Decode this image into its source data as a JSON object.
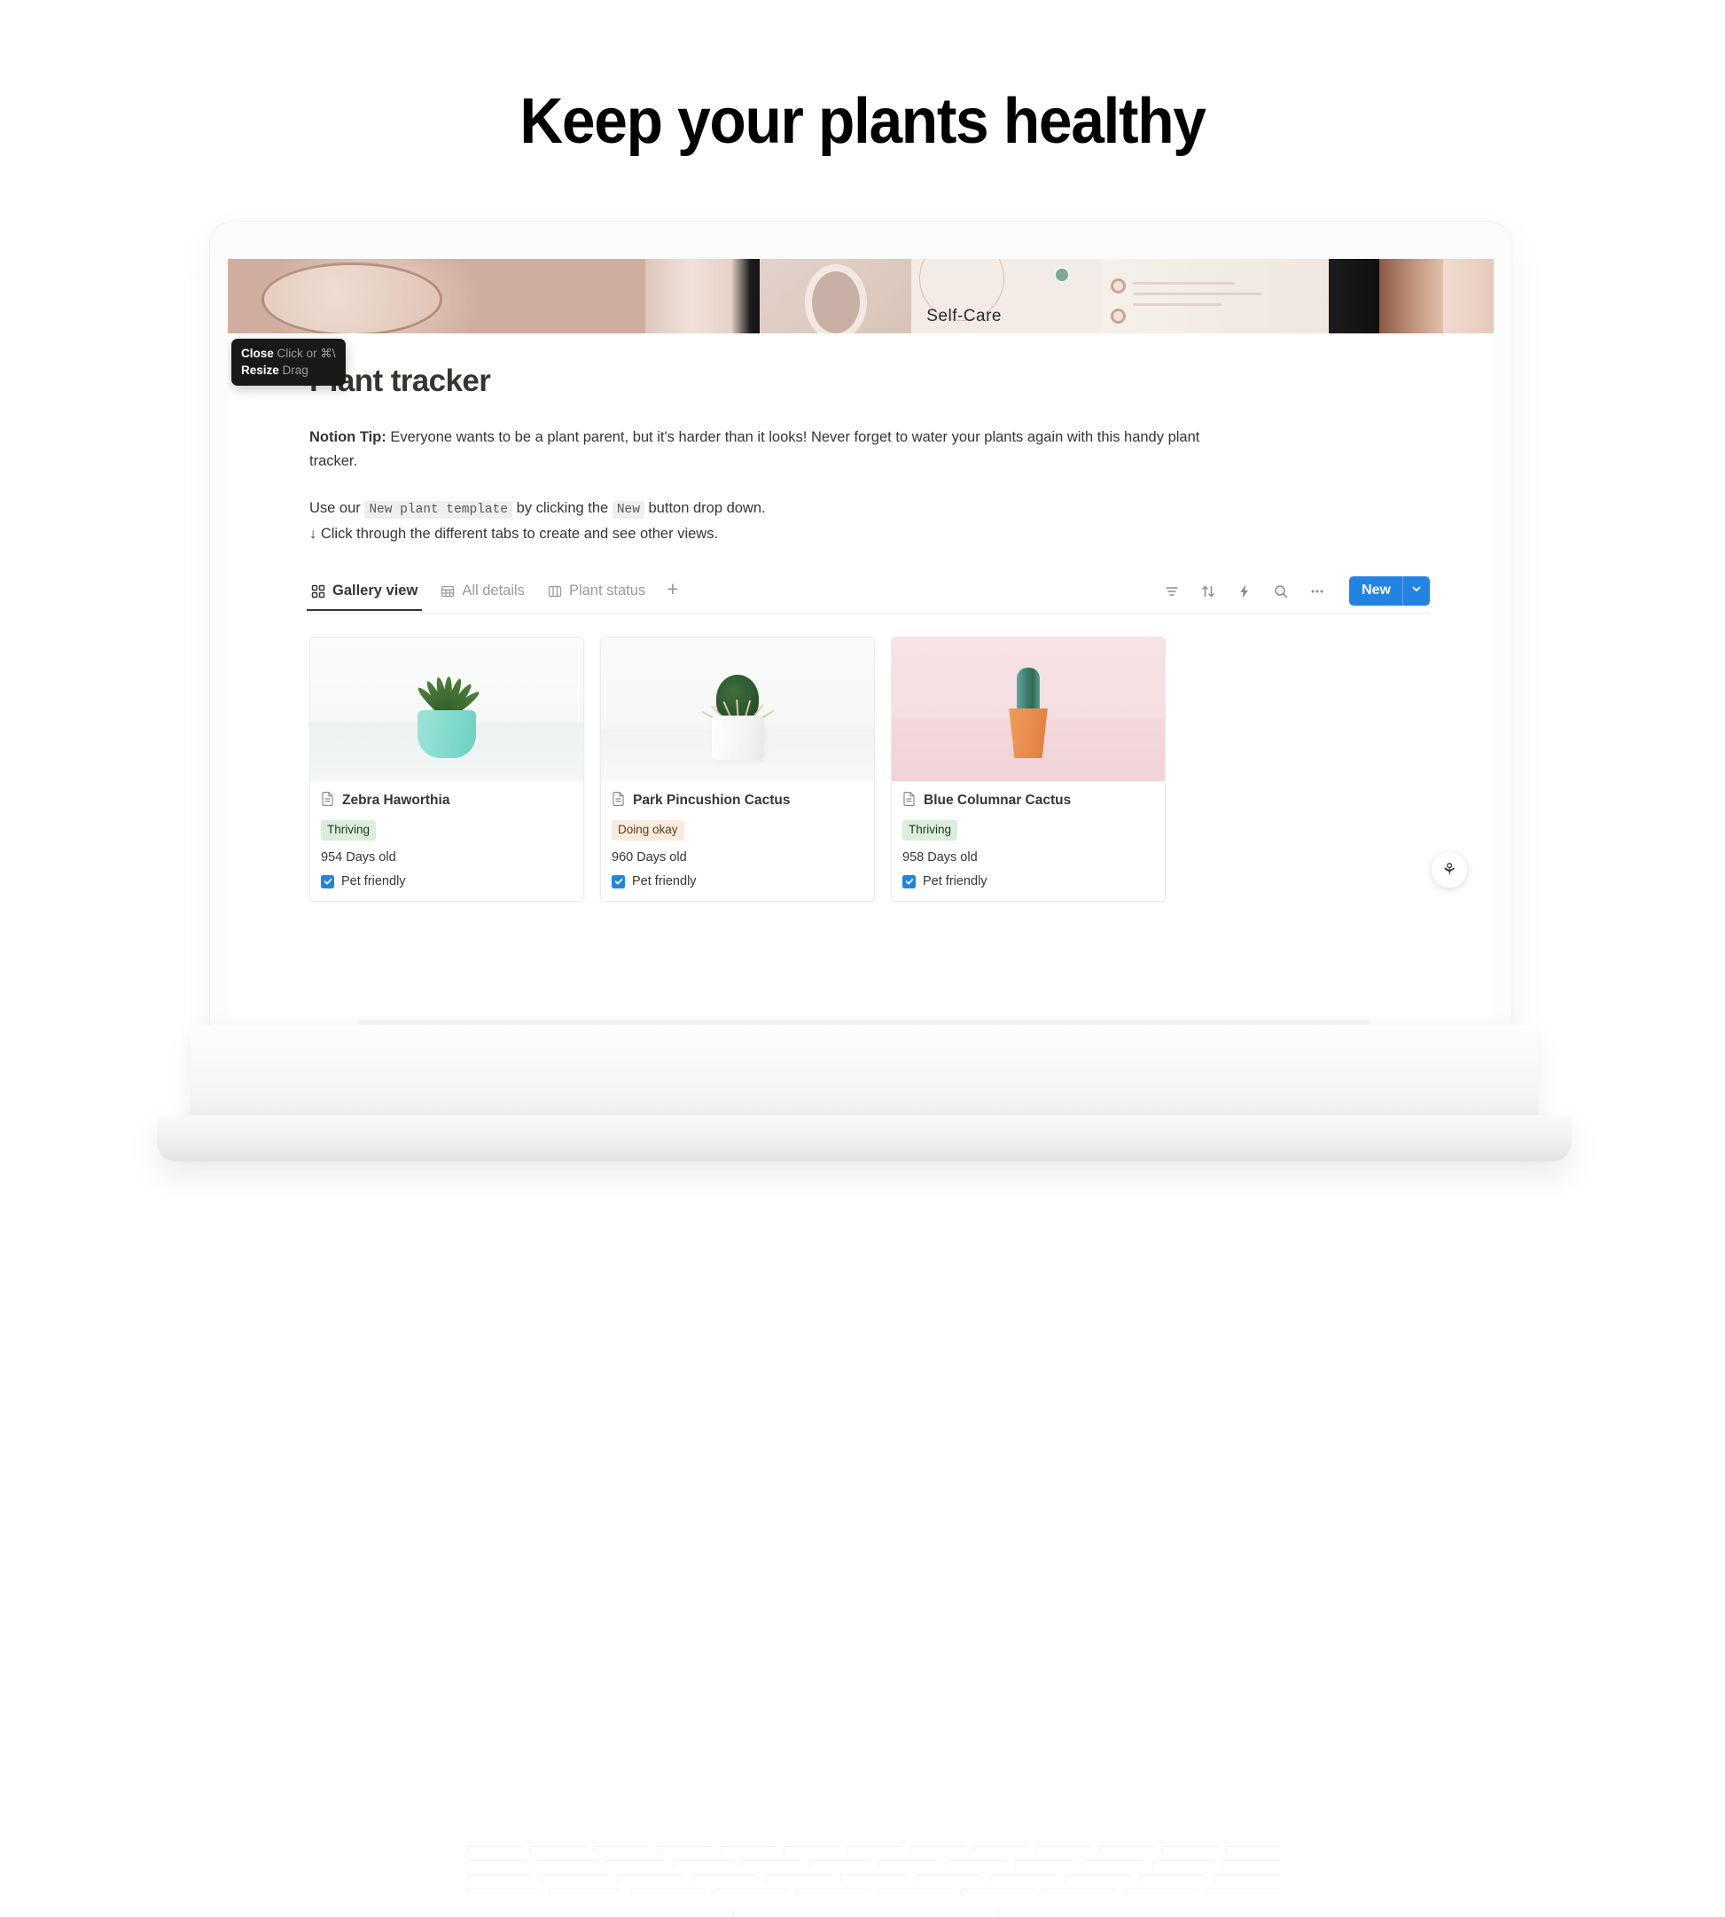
{
  "headline": "Keep your plants healthy",
  "notion": {
    "tooltip": {
      "close_label": "Close",
      "close_shortcut": "Click or ⌘\\",
      "resize_label": "Resize",
      "resize_shortcut": "Drag"
    },
    "page_title": "Plant tracker",
    "paragraphs": {
      "tip_label": "Notion Tip:",
      "tip_text": " Everyone wants to be a plant parent, but it's harder than it looks! Never forget to water your plants again with this handy plant tracker.",
      "use_prefix": "Use our ",
      "code_template": "New plant template",
      "use_mid": " by clicking the ",
      "code_new": "New",
      "use_suffix": " button drop down.",
      "tabs_hint": "↓ Click through the different tabs to create and see other views."
    },
    "views": [
      {
        "label": "Gallery view",
        "icon": "gallery-grid-icon",
        "active": true
      },
      {
        "label": "All details",
        "icon": "table-icon",
        "active": false
      },
      {
        "label": "Plant status",
        "icon": "board-icon",
        "active": false
      }
    ],
    "add_view_label": "+",
    "toolbar": {
      "filter_icon": "filter-icon",
      "sort_icon": "sort-icon",
      "automation_icon": "lightning-bolt-icon",
      "search_icon": "search-icon",
      "more_icon": "more-horizontal-icon",
      "new_label": "New",
      "new_caret_icon": "chevron-down-icon"
    },
    "cards": [
      {
        "title": "Zebra Haworthia",
        "status": "Thriving",
        "status_color": "green",
        "age": "954 Days old",
        "pet_friendly_label": "Pet friendly",
        "pet_friendly": true,
        "image": "zebra-haworthia-mint-pot"
      },
      {
        "title": "Park Pincushion Cactus",
        "status": "Doing okay",
        "status_color": "orange",
        "age": "960 Days old",
        "pet_friendly_label": "Pet friendly",
        "pet_friendly": true,
        "image": "pincushion-cactus-white-pot"
      },
      {
        "title": "Blue Columnar Cactus",
        "status": "Thriving",
        "status_color": "green",
        "age": "958 Days old",
        "pet_friendly_label": "Pet friendly",
        "pet_friendly": true,
        "image": "blue-columnar-cactus-terracotta-pot"
      }
    ],
    "cover": {
      "self_care_text": "Self-Care"
    },
    "help_button_glyph": "⚘"
  },
  "colors": {
    "accent_blue": "#2383e2",
    "status_green_bg": "#dbeddb",
    "status_green_text": "#1c3829",
    "status_orange_bg": "#faebdd",
    "status_orange_text": "#5c3b23",
    "text_primary": "#37352f",
    "text_muted": "#9b9a97"
  }
}
